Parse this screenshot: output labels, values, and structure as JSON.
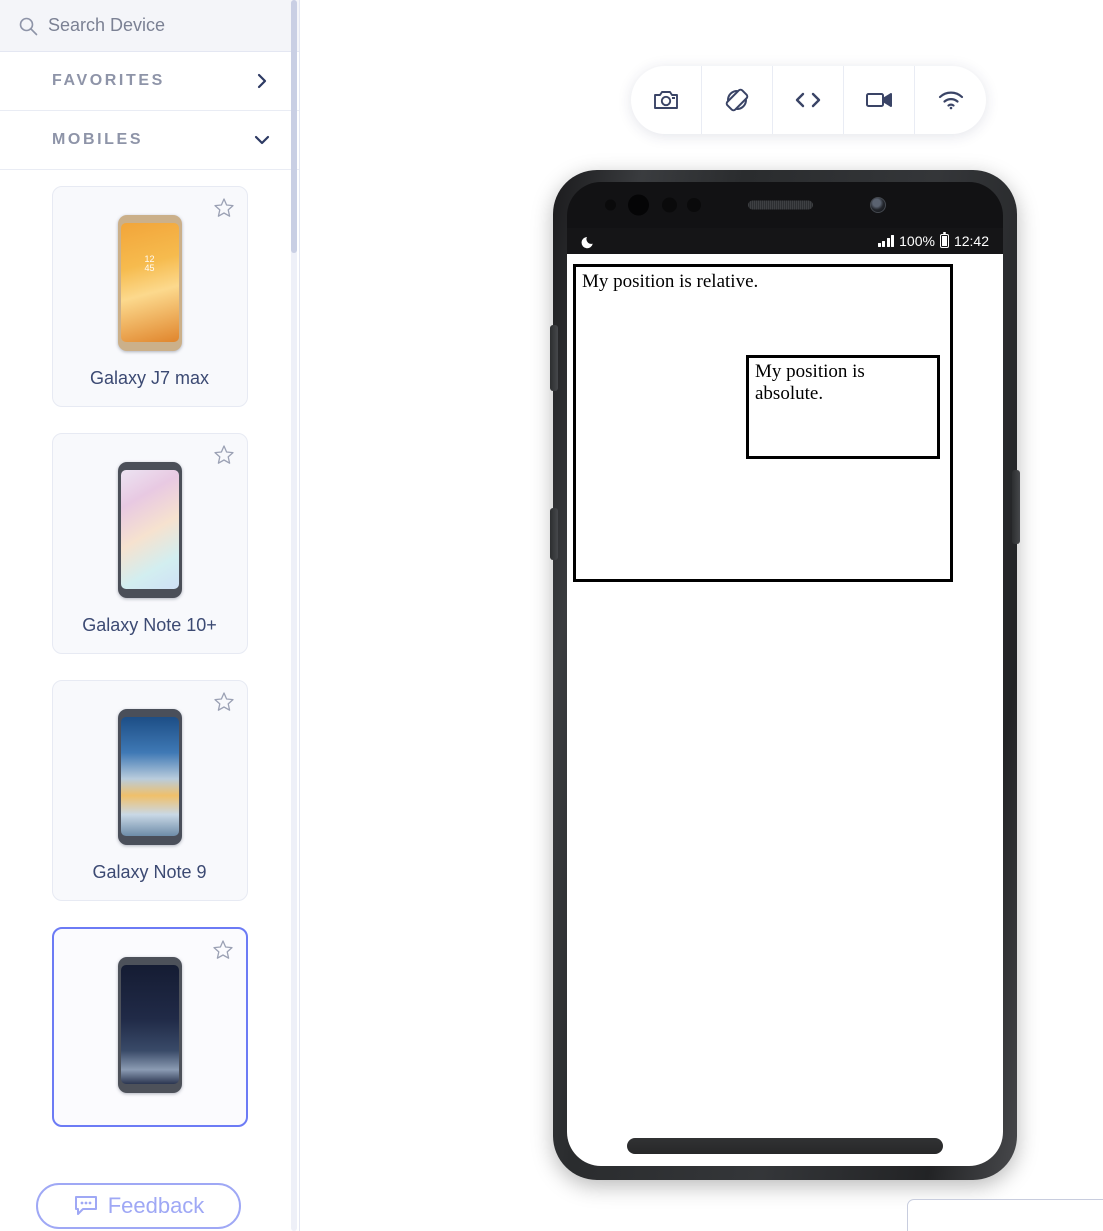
{
  "sidebar": {
    "search": {
      "placeholder": "Search Device",
      "value": "",
      "icon": "search-icon"
    },
    "sections": [
      {
        "title": "FAVORITES",
        "state": "collapsed",
        "chevron": "chevron-right-icon"
      },
      {
        "title": "MOBILES",
        "state": "expanded",
        "chevron": "chevron-down-icon"
      }
    ],
    "devices": [
      {
        "name": "Galaxy J7 max",
        "favorite": false,
        "selected": false,
        "star_icon": "star-outline-icon"
      },
      {
        "name": "Galaxy Note 10+",
        "favorite": false,
        "selected": false,
        "star_icon": "star-outline-icon"
      },
      {
        "name": "Galaxy Note 9",
        "favorite": false,
        "selected": false,
        "star_icon": "star-outline-icon"
      },
      {
        "name": "",
        "favorite": false,
        "selected": true,
        "star_icon": "star-outline-icon"
      }
    ],
    "feedback": {
      "label": "Feedback",
      "icon": "chat-bubble-icon",
      "color": "#9fa8f5"
    }
  },
  "toolbar": {
    "buttons": [
      {
        "name": "screenshot",
        "icon": "camera-icon"
      },
      {
        "name": "rotate",
        "icon": "screen-rotation-icon"
      },
      {
        "name": "devtools",
        "icon": "code-brackets-icon"
      },
      {
        "name": "record",
        "icon": "video-camera-icon"
      },
      {
        "name": "network",
        "icon": "wifi-icon"
      }
    ]
  },
  "device_preview": {
    "status_bar": {
      "dnd_icon": "crescent-moon-icon",
      "signal_icon": "signal-bars-icon",
      "battery_percent": "100%",
      "battery_icon": "battery-full-icon",
      "time": "12:42"
    },
    "page": {
      "relative_text": "My position is relative.",
      "absolute_text": "My position is absolute."
    }
  },
  "colors": {
    "accent": "#6c7bf5",
    "feedback": "#9fa8f5",
    "label": "#3c4a73",
    "section": "#8e94a8",
    "toolbar_icon": "#3a4466"
  }
}
